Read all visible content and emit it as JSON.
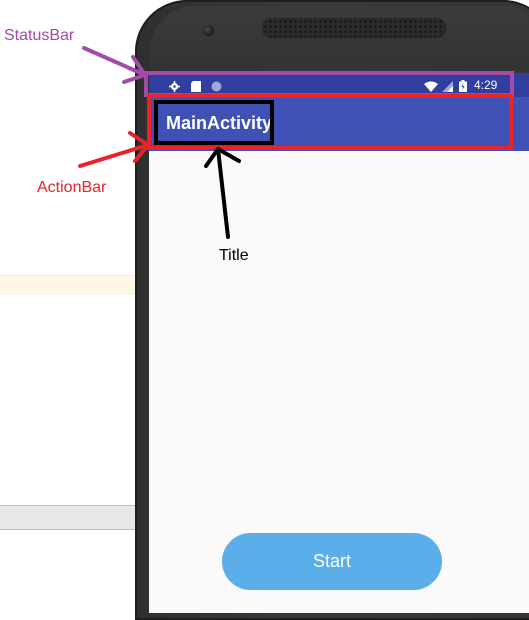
{
  "annotations": {
    "status_bar_label": "StatusBar",
    "action_bar_label": "ActionBar",
    "title_label": "Title",
    "colors": {
      "status_bar": "#a24ca8",
      "action_bar": "#ea2229",
      "title": "#000000"
    }
  },
  "phone": {
    "status_bar": {
      "time": "4:29",
      "left_icons": [
        "gear-icon",
        "sd-card-icon",
        "circle-icon"
      ],
      "right_icons": [
        "wifi-icon",
        "signal-icon",
        "battery-icon"
      ],
      "color": "#303f9f"
    },
    "action_bar": {
      "title": "MainActivity",
      "color": "#3f51b5"
    },
    "main": {
      "start_button_label": "Start",
      "start_button_color": "#5aaeea"
    }
  }
}
